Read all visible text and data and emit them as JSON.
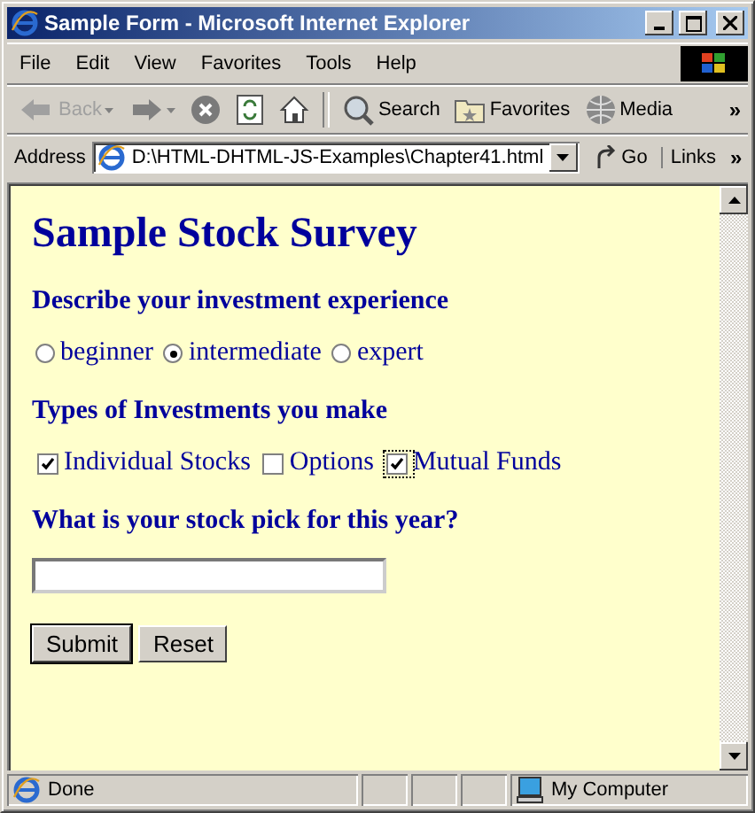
{
  "window": {
    "title": "Sample Form - Microsoft Internet Explorer"
  },
  "menu": [
    "File",
    "Edit",
    "View",
    "Favorites",
    "Tools",
    "Help"
  ],
  "toolbar": {
    "items": [
      {
        "kind": "back",
        "label": "Back",
        "disabled": true
      },
      {
        "kind": "forward"
      },
      {
        "kind": "stop"
      },
      {
        "kind": "refresh"
      },
      {
        "kind": "home"
      },
      {
        "kind": "search",
        "label": "Search"
      },
      {
        "kind": "favorites",
        "label": "Favorites"
      },
      {
        "kind": "media",
        "label": "Media"
      }
    ],
    "more": "»"
  },
  "address": {
    "label": "Address",
    "value": "D:\\HTML-DHTML-JS-Examples\\Chapter41.html",
    "go": "Go",
    "links": "Links",
    "more": "»"
  },
  "page": {
    "title": "Sample Stock Survey",
    "sections": [
      {
        "heading": "Describe your investment experience",
        "kind": "radio",
        "options": [
          {
            "label": "beginner",
            "selected": false,
            "focused": false
          },
          {
            "label": "intermediate",
            "selected": true,
            "focused": false
          },
          {
            "label": "expert",
            "selected": false,
            "focused": false
          }
        ]
      },
      {
        "heading": "Types of Investments you make",
        "kind": "checkbox",
        "options": [
          {
            "label": "Individual Stocks",
            "checked": true,
            "focused": false
          },
          {
            "label": "Options",
            "checked": false,
            "focused": false
          },
          {
            "label": "Mutual Funds",
            "checked": true,
            "focused": true
          }
        ]
      },
      {
        "heading": "What is your stock pick for this year?",
        "kind": "text"
      }
    ],
    "buttons": [
      {
        "label": "Submit",
        "default": true
      },
      {
        "label": "Reset",
        "default": false
      }
    ]
  },
  "status_bar": {
    "text": "Done",
    "zone": "My Computer"
  }
}
